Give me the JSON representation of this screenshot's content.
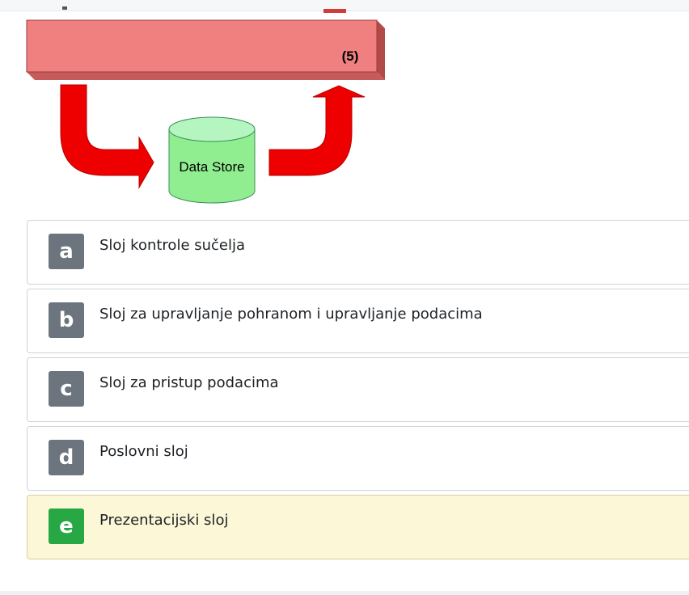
{
  "diagram": {
    "layer_label": "(5)",
    "data_store_label": "Data Store"
  },
  "options": [
    {
      "letter": "a",
      "text": "Sloj kontrole sučelja",
      "selected": false
    },
    {
      "letter": "b",
      "text": "Sloj za upravljanje pohranom i upravljanje podacima",
      "selected": false
    },
    {
      "letter": "c",
      "text": "Sloj za pristup podacima",
      "selected": false
    },
    {
      "letter": "d",
      "text": "Poslovni sloj",
      "selected": false
    },
    {
      "letter": "e",
      "text": "Prezentacijski sloj",
      "selected": true
    }
  ],
  "colors": {
    "badge_default": "#6c757d",
    "badge_selected": "#28a745",
    "selected_background": "#fcf8d7",
    "layer_bar": "#f08080",
    "arrow": "#ee0000",
    "data_store": "#90ee90"
  }
}
